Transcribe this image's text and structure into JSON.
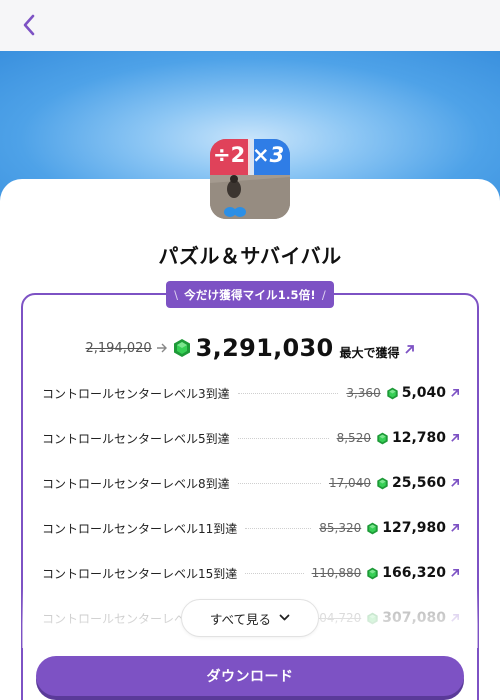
{
  "header": {
    "back_icon": "chevron-left-icon"
  },
  "app": {
    "title": "パズル＆サバイバル",
    "icon_text_1": "÷2",
    "icon_text_2": "×3"
  },
  "promo": {
    "badge_text": "今だけ獲得マイル1.5倍!"
  },
  "summary": {
    "old_value": "2,194,020",
    "new_value": "3,291,030",
    "suffix": "最大で獲得"
  },
  "rows": [
    {
      "label": "コントロールセンターレベル3到達",
      "old": "3,360",
      "value": "5,040"
    },
    {
      "label": "コントロールセンターレベル5到達",
      "old": "8,520",
      "value": "12,780"
    },
    {
      "label": "コントロールセンターレベル8到達",
      "old": "17,040",
      "value": "25,560"
    },
    {
      "label": "コントロールセンターレベル11到達",
      "old": "85,320",
      "value": "127,980"
    },
    {
      "label": "コントロールセンターレベル15到達",
      "old": "110,880",
      "value": "166,320"
    },
    {
      "label": "コントロールセンターレベル20到達",
      "old": "204,720",
      "value": "307,080"
    }
  ],
  "see_all": {
    "label": "すべて見る"
  },
  "download": {
    "label": "ダウンロード"
  },
  "colors": {
    "accent": "#7d52c4",
    "gem": "#2fbf4a",
    "hero": "#3a90de"
  }
}
